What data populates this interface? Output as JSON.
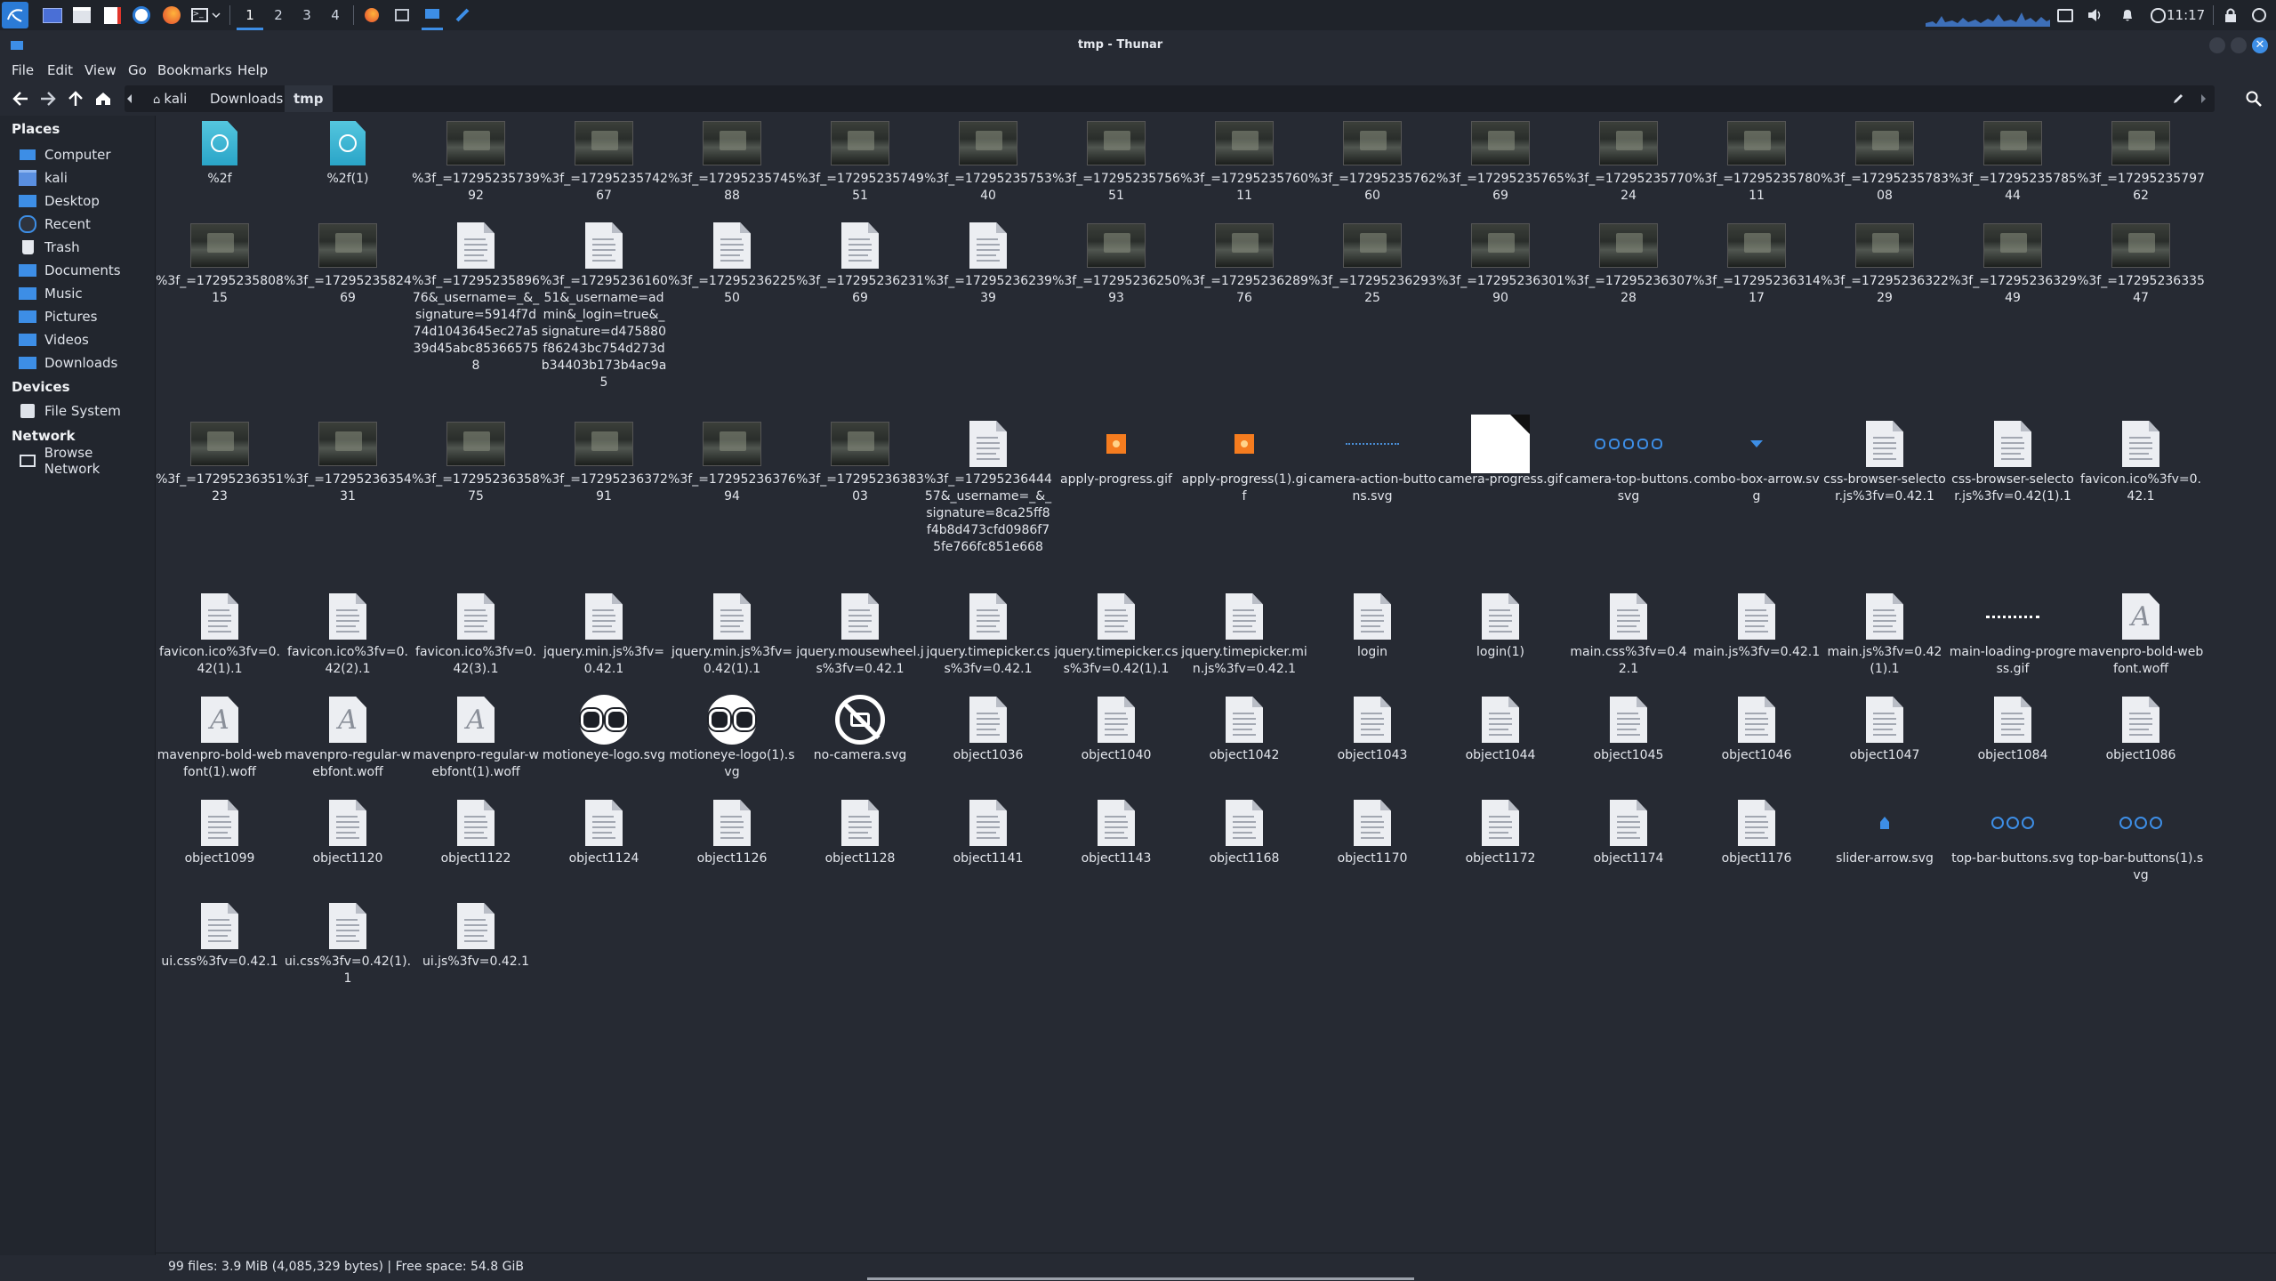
{
  "window": {
    "title": "tmp - Thunar"
  },
  "panel": {
    "workspaces": [
      "1",
      "2",
      "3",
      "4"
    ],
    "clock": "11:17"
  },
  "menu": [
    "File",
    "Edit",
    "View",
    "Go",
    "Bookmarks",
    "Help"
  ],
  "breadcrumb": [
    "kali",
    "Downloads",
    "tmp"
  ],
  "sidebar": {
    "places_title": "Places",
    "places": [
      "Computer",
      "kali",
      "Desktop",
      "Recent",
      "Trash",
      "Documents",
      "Music",
      "Pictures",
      "Videos",
      "Downloads"
    ],
    "devices_title": "Devices",
    "devices": [
      "File System"
    ],
    "network_title": "Network",
    "network": [
      "Browse Network"
    ]
  },
  "status": "99 files: 3.9 MiB (4,085,329 bytes)  |  Free space: 54.8 GiB",
  "files": [
    {
      "name": "%2f",
      "icon": "globe"
    },
    {
      "name": "%2f(1)",
      "icon": "globe"
    },
    {
      "name": "%3f_=1729523573992",
      "icon": "image"
    },
    {
      "name": "%3f_=1729523574267",
      "icon": "image"
    },
    {
      "name": "%3f_=1729523574588",
      "icon": "image"
    },
    {
      "name": "%3f_=1729523574951",
      "icon": "image"
    },
    {
      "name": "%3f_=1729523575340",
      "icon": "image"
    },
    {
      "name": "%3f_=1729523575651",
      "icon": "image"
    },
    {
      "name": "%3f_=1729523576011",
      "icon": "image"
    },
    {
      "name": "%3f_=1729523576260",
      "icon": "image"
    },
    {
      "name": "%3f_=1729523576569",
      "icon": "image"
    },
    {
      "name": "%3f_=1729523577024",
      "icon": "image"
    },
    {
      "name": "%3f_=1729523578011",
      "icon": "image"
    },
    {
      "name": "%3f_=1729523578308",
      "icon": "image"
    },
    {
      "name": "%3f_=1729523578544",
      "icon": "image"
    },
    {
      "name": "%3f_=1729523579762",
      "icon": "image"
    },
    {
      "name": "%3f_=1729523580815",
      "icon": "image"
    },
    {
      "name": "%3f_=1729523582469",
      "icon": "image"
    },
    {
      "name": "%3f_=1729523589676&_username=_&_signature=5914f7d74d1043645ec27a539d45abc853665758",
      "icon": "doc"
    },
    {
      "name": "%3f_=1729523616051&_username=admin&_login=true&_signature=d475880f86243bc754d273db34403b173b4ac9a5",
      "icon": "doc"
    },
    {
      "name": "%3f_=1729523622550",
      "icon": "doc"
    },
    {
      "name": "%3f_=1729523623169",
      "icon": "doc"
    },
    {
      "name": "%3f_=1729523623939",
      "icon": "doc"
    },
    {
      "name": "%3f_=1729523625093",
      "icon": "image"
    },
    {
      "name": "%3f_=1729523628976",
      "icon": "image"
    },
    {
      "name": "%3f_=1729523629325",
      "icon": "image"
    },
    {
      "name": "%3f_=1729523630190",
      "icon": "image"
    },
    {
      "name": "%3f_=1729523630728",
      "icon": "image"
    },
    {
      "name": "%3f_=1729523631417",
      "icon": "image"
    },
    {
      "name": "%3f_=1729523632229",
      "icon": "image"
    },
    {
      "name": "%3f_=1729523632949",
      "icon": "image"
    },
    {
      "name": "%3f_=1729523633547",
      "icon": "image"
    },
    {
      "name": "%3f_=1729523635123",
      "icon": "image"
    },
    {
      "name": "%3f_=1729523635431",
      "icon": "image"
    },
    {
      "name": "%3f_=1729523635875",
      "icon": "image"
    },
    {
      "name": "%3f_=1729523637291",
      "icon": "image"
    },
    {
      "name": "%3f_=1729523637694",
      "icon": "image"
    },
    {
      "name": "%3f_=1729523638303",
      "icon": "image"
    },
    {
      "name": "%3f_=1729523644457&_username=_&_signature=8ca25ff8f4b8d473cfd0986f75fe766fc851e668",
      "icon": "doc"
    },
    {
      "name": "apply-progress.gif",
      "icon": "orange"
    },
    {
      "name": "apply-progress(1).gif",
      "icon": "orange"
    },
    {
      "name": "camera-action-buttons.svg",
      "icon": "dotline"
    },
    {
      "name": "camera-progress.gif",
      "icon": "whitepage"
    },
    {
      "name": "camera-top-buttons.svg",
      "icon": "bluedots"
    },
    {
      "name": "combo-box-arrow.svg",
      "icon": "arrow"
    },
    {
      "name": "css-browser-selector.js%3fv=0.42.1",
      "icon": "doc"
    },
    {
      "name": "css-browser-selector.js%3fv=0.42(1).1",
      "icon": "doc"
    },
    {
      "name": "favicon.ico%3fv=0.42.1",
      "icon": "doc"
    },
    {
      "name": "favicon.ico%3fv=0.42(1).1",
      "icon": "doc"
    },
    {
      "name": "favicon.ico%3fv=0.42(2).1",
      "icon": "doc"
    },
    {
      "name": "favicon.ico%3fv=0.42(3).1",
      "icon": "doc"
    },
    {
      "name": "jquery.min.js%3fv=0.42.1",
      "icon": "doc"
    },
    {
      "name": "jquery.min.js%3fv=0.42(1).1",
      "icon": "doc"
    },
    {
      "name": "jquery.mousewheel.js%3fv=0.42.1",
      "icon": "doc"
    },
    {
      "name": "jquery.timepicker.css%3fv=0.42.1",
      "icon": "doc"
    },
    {
      "name": "jquery.timepicker.css%3fv=0.42(1).1",
      "icon": "doc"
    },
    {
      "name": "jquery.timepicker.min.js%3fv=0.42.1",
      "icon": "doc"
    },
    {
      "name": "login",
      "icon": "doc"
    },
    {
      "name": "login(1)",
      "icon": "doc"
    },
    {
      "name": "main.css%3fv=0.42.1",
      "icon": "doc"
    },
    {
      "name": "main.js%3fv=0.42.1",
      "icon": "doc"
    },
    {
      "name": "main.js%3fv=0.42(1).1",
      "icon": "doc"
    },
    {
      "name": "main-loading-progress.gif",
      "icon": "dots"
    },
    {
      "name": "mavenpro-bold-webfont.woff",
      "icon": "font"
    },
    {
      "name": "mavenpro-bold-webfont(1).woff",
      "icon": "font"
    },
    {
      "name": "mavenpro-regular-webfont.woff",
      "icon": "font"
    },
    {
      "name": "mavenpro-regular-webfont(1).woff",
      "icon": "font"
    },
    {
      "name": "motioneye-logo.svg",
      "icon": "owl"
    },
    {
      "name": "motioneye-logo(1).svg",
      "icon": "owl"
    },
    {
      "name": "no-camera.svg",
      "icon": "nocam"
    },
    {
      "name": "object1036",
      "icon": "doc"
    },
    {
      "name": "object1040",
      "icon": "doc"
    },
    {
      "name": "object1042",
      "icon": "doc"
    },
    {
      "name": "object1043",
      "icon": "doc"
    },
    {
      "name": "object1044",
      "icon": "doc"
    },
    {
      "name": "object1045",
      "icon": "doc"
    },
    {
      "name": "object1046",
      "icon": "doc"
    },
    {
      "name": "object1047",
      "icon": "doc"
    },
    {
      "name": "object1084",
      "icon": "doc"
    },
    {
      "name": "object1086",
      "icon": "doc"
    },
    {
      "name": "object1099",
      "icon": "doc"
    },
    {
      "name": "object1120",
      "icon": "doc"
    },
    {
      "name": "object1122",
      "icon": "doc"
    },
    {
      "name": "object1124",
      "icon": "doc"
    },
    {
      "name": "object1126",
      "icon": "doc"
    },
    {
      "name": "object1128",
      "icon": "doc"
    },
    {
      "name": "object1141",
      "icon": "doc"
    },
    {
      "name": "object1143",
      "icon": "doc"
    },
    {
      "name": "object1168",
      "icon": "doc"
    },
    {
      "name": "object1170",
      "icon": "doc"
    },
    {
      "name": "object1172",
      "icon": "doc"
    },
    {
      "name": "object1174",
      "icon": "doc"
    },
    {
      "name": "object1176",
      "icon": "doc"
    },
    {
      "name": "slider-arrow.svg",
      "icon": "bluepin"
    },
    {
      "name": "top-bar-buttons.svg",
      "icon": "bluecircles"
    },
    {
      "name": "top-bar-buttons(1).svg",
      "icon": "bluecircles"
    },
    {
      "name": "ui.css%3fv=0.42.1",
      "icon": "doc"
    },
    {
      "name": "ui.css%3fv=0.42(1).1",
      "icon": "doc"
    },
    {
      "name": "ui.js%3fv=0.42.1",
      "icon": "doc"
    }
  ]
}
